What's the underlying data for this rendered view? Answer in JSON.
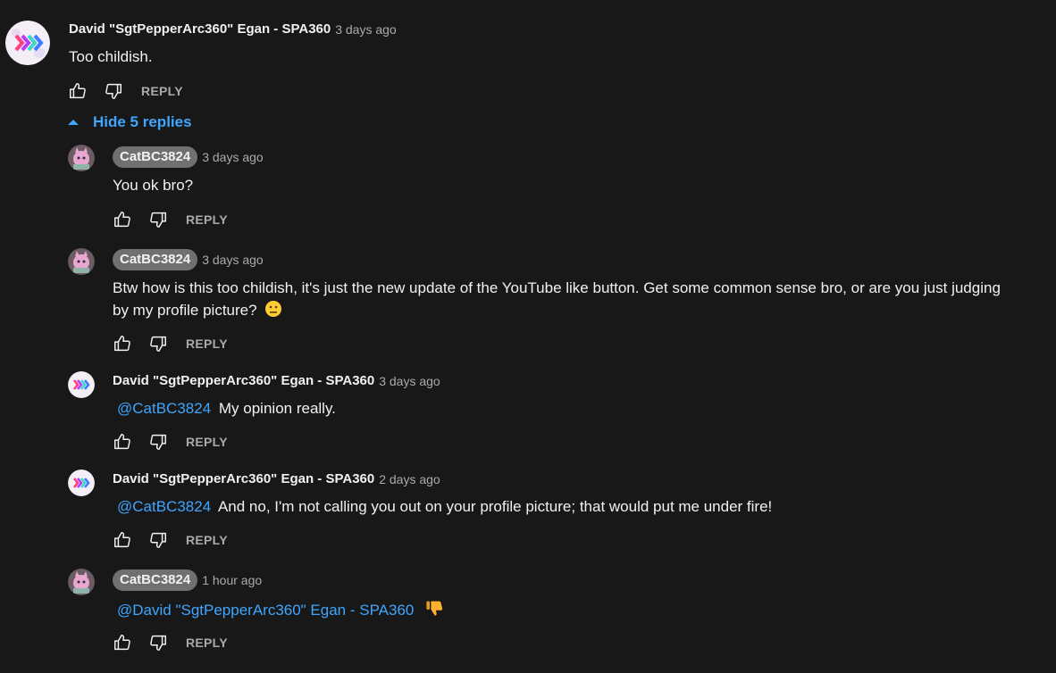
{
  "top_comment": {
    "author": "David \"SgtPepperArc360\" Egan - SPA360",
    "time": "3 days ago",
    "text": "Too childish.",
    "reply_label": "REPLY"
  },
  "replies_toggle": {
    "label": "Hide 5 replies"
  },
  "replies": [
    {
      "author": "CatBC3824",
      "time": "3 days ago",
      "text": "You ok bro?",
      "reply_label": "REPLY"
    },
    {
      "author": "CatBC3824",
      "time": "3 days ago",
      "text_line1": "Btw how is this too childish, it's just the new update of the YouTube like button. Get some common sense bro, or are you just judging",
      "text_line2": "by my profile picture?",
      "emoji": "neutral-face",
      "reply_label": "REPLY"
    },
    {
      "author": "David \"SgtPepperArc360\" Egan - SPA360",
      "time": "3 days ago",
      "mention": "@CatBC3824",
      "text": "My opinion really.",
      "reply_label": "REPLY"
    },
    {
      "author": "David \"SgtPepperArc360\" Egan - SPA360",
      "time": "2 days ago",
      "mention": "@CatBC3824",
      "text": "And no, I'm not calling you out on your profile picture; that would put me under fire!",
      "reply_label": "REPLY"
    },
    {
      "author": "CatBC3824",
      "time": "1 hour ago",
      "mention": "@David \"SgtPepperArc360\" Egan - SPA360",
      "emoji": "thumbs-down",
      "reply_label": "REPLY"
    }
  ],
  "colors": {
    "background": "#181818",
    "text": "#f1f1f1",
    "secondary": "#aaaaaa",
    "link": "#3ea6ff",
    "badge": "#707070"
  }
}
